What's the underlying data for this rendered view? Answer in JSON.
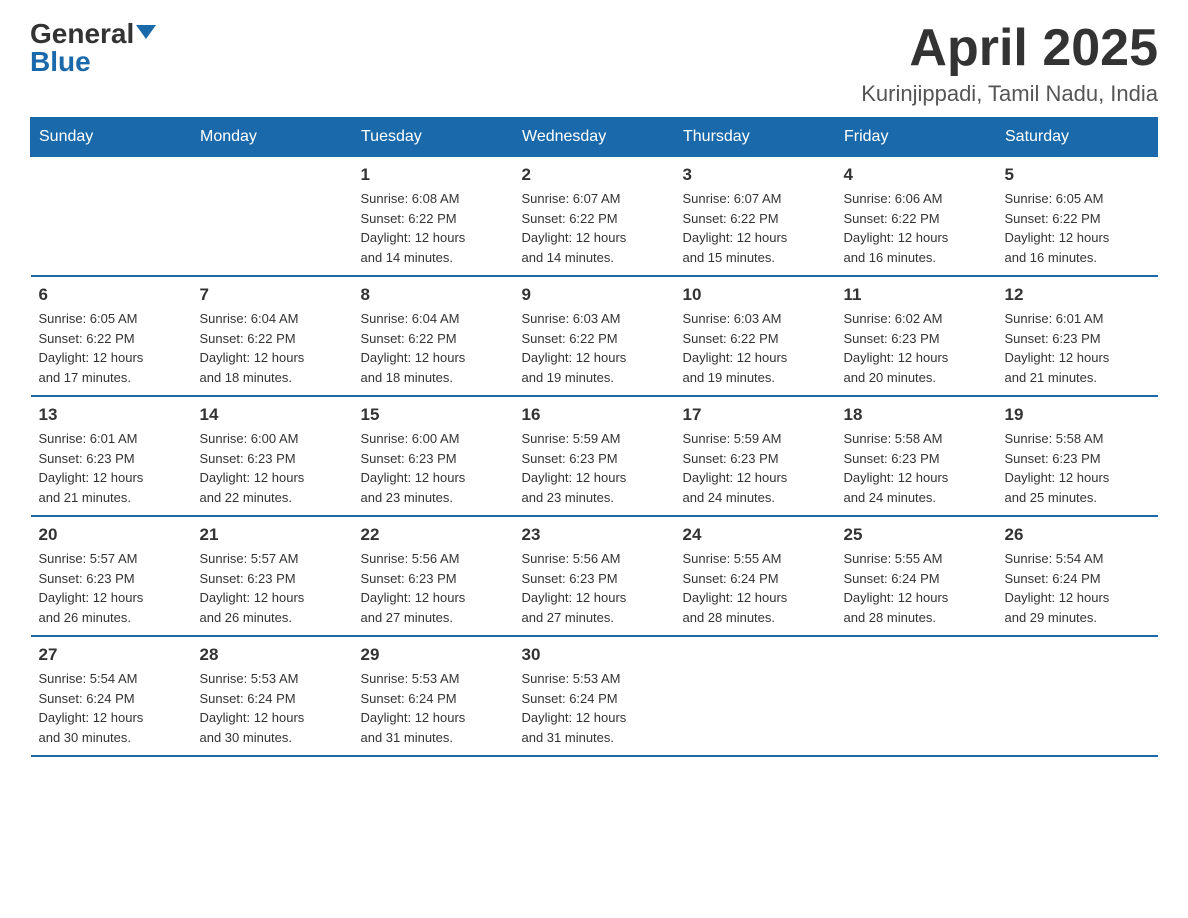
{
  "header": {
    "logo_general": "General",
    "logo_blue": "Blue",
    "month_title": "April 2025",
    "location": "Kurinjippadi, Tamil Nadu, India"
  },
  "days_of_week": [
    "Sunday",
    "Monday",
    "Tuesday",
    "Wednesday",
    "Thursday",
    "Friday",
    "Saturday"
  ],
  "weeks": [
    [
      {
        "day": "",
        "info": ""
      },
      {
        "day": "",
        "info": ""
      },
      {
        "day": "1",
        "info": "Sunrise: 6:08 AM\nSunset: 6:22 PM\nDaylight: 12 hours\nand 14 minutes."
      },
      {
        "day": "2",
        "info": "Sunrise: 6:07 AM\nSunset: 6:22 PM\nDaylight: 12 hours\nand 14 minutes."
      },
      {
        "day": "3",
        "info": "Sunrise: 6:07 AM\nSunset: 6:22 PM\nDaylight: 12 hours\nand 15 minutes."
      },
      {
        "day": "4",
        "info": "Sunrise: 6:06 AM\nSunset: 6:22 PM\nDaylight: 12 hours\nand 16 minutes."
      },
      {
        "day": "5",
        "info": "Sunrise: 6:05 AM\nSunset: 6:22 PM\nDaylight: 12 hours\nand 16 minutes."
      }
    ],
    [
      {
        "day": "6",
        "info": "Sunrise: 6:05 AM\nSunset: 6:22 PM\nDaylight: 12 hours\nand 17 minutes."
      },
      {
        "day": "7",
        "info": "Sunrise: 6:04 AM\nSunset: 6:22 PM\nDaylight: 12 hours\nand 18 minutes."
      },
      {
        "day": "8",
        "info": "Sunrise: 6:04 AM\nSunset: 6:22 PM\nDaylight: 12 hours\nand 18 minutes."
      },
      {
        "day": "9",
        "info": "Sunrise: 6:03 AM\nSunset: 6:22 PM\nDaylight: 12 hours\nand 19 minutes."
      },
      {
        "day": "10",
        "info": "Sunrise: 6:03 AM\nSunset: 6:22 PM\nDaylight: 12 hours\nand 19 minutes."
      },
      {
        "day": "11",
        "info": "Sunrise: 6:02 AM\nSunset: 6:23 PM\nDaylight: 12 hours\nand 20 minutes."
      },
      {
        "day": "12",
        "info": "Sunrise: 6:01 AM\nSunset: 6:23 PM\nDaylight: 12 hours\nand 21 minutes."
      }
    ],
    [
      {
        "day": "13",
        "info": "Sunrise: 6:01 AM\nSunset: 6:23 PM\nDaylight: 12 hours\nand 21 minutes."
      },
      {
        "day": "14",
        "info": "Sunrise: 6:00 AM\nSunset: 6:23 PM\nDaylight: 12 hours\nand 22 minutes."
      },
      {
        "day": "15",
        "info": "Sunrise: 6:00 AM\nSunset: 6:23 PM\nDaylight: 12 hours\nand 23 minutes."
      },
      {
        "day": "16",
        "info": "Sunrise: 5:59 AM\nSunset: 6:23 PM\nDaylight: 12 hours\nand 23 minutes."
      },
      {
        "day": "17",
        "info": "Sunrise: 5:59 AM\nSunset: 6:23 PM\nDaylight: 12 hours\nand 24 minutes."
      },
      {
        "day": "18",
        "info": "Sunrise: 5:58 AM\nSunset: 6:23 PM\nDaylight: 12 hours\nand 24 minutes."
      },
      {
        "day": "19",
        "info": "Sunrise: 5:58 AM\nSunset: 6:23 PM\nDaylight: 12 hours\nand 25 minutes."
      }
    ],
    [
      {
        "day": "20",
        "info": "Sunrise: 5:57 AM\nSunset: 6:23 PM\nDaylight: 12 hours\nand 26 minutes."
      },
      {
        "day": "21",
        "info": "Sunrise: 5:57 AM\nSunset: 6:23 PM\nDaylight: 12 hours\nand 26 minutes."
      },
      {
        "day": "22",
        "info": "Sunrise: 5:56 AM\nSunset: 6:23 PM\nDaylight: 12 hours\nand 27 minutes."
      },
      {
        "day": "23",
        "info": "Sunrise: 5:56 AM\nSunset: 6:23 PM\nDaylight: 12 hours\nand 27 minutes."
      },
      {
        "day": "24",
        "info": "Sunrise: 5:55 AM\nSunset: 6:24 PM\nDaylight: 12 hours\nand 28 minutes."
      },
      {
        "day": "25",
        "info": "Sunrise: 5:55 AM\nSunset: 6:24 PM\nDaylight: 12 hours\nand 28 minutes."
      },
      {
        "day": "26",
        "info": "Sunrise: 5:54 AM\nSunset: 6:24 PM\nDaylight: 12 hours\nand 29 minutes."
      }
    ],
    [
      {
        "day": "27",
        "info": "Sunrise: 5:54 AM\nSunset: 6:24 PM\nDaylight: 12 hours\nand 30 minutes."
      },
      {
        "day": "28",
        "info": "Sunrise: 5:53 AM\nSunset: 6:24 PM\nDaylight: 12 hours\nand 30 minutes."
      },
      {
        "day": "29",
        "info": "Sunrise: 5:53 AM\nSunset: 6:24 PM\nDaylight: 12 hours\nand 31 minutes."
      },
      {
        "day": "30",
        "info": "Sunrise: 5:53 AM\nSunset: 6:24 PM\nDaylight: 12 hours\nand 31 minutes."
      },
      {
        "day": "",
        "info": ""
      },
      {
        "day": "",
        "info": ""
      },
      {
        "day": "",
        "info": ""
      }
    ]
  ]
}
